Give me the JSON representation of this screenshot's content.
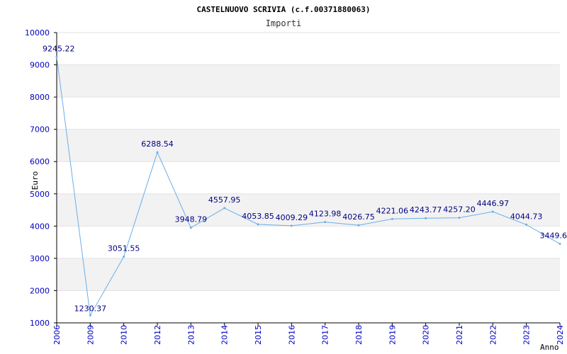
{
  "chart_data": {
    "type": "line",
    "title": "CASTELNUOVO SCRIVIA (c.f.00371880063)",
    "subtitle": "Importi",
    "xlabel": "Anno",
    "ylabel": "Euro",
    "ylim": [
      1000,
      10000
    ],
    "yticks": [
      1000,
      2000,
      3000,
      4000,
      5000,
      6000,
      7000,
      8000,
      9000,
      10000
    ],
    "grid": "alternating horizontal bands",
    "categories": [
      "2006",
      "2009",
      "2010",
      "2012",
      "2013",
      "2014",
      "2015",
      "2016",
      "2017",
      "2018",
      "2019",
      "2020",
      "2021",
      "2022",
      "2023",
      "2024"
    ],
    "series": [
      {
        "values": [
          9245.22,
          1230.37,
          3051.55,
          6288.54,
          3948.79,
          4557.95,
          4053.85,
          4009.29,
          4123.98,
          4026.75,
          4221.06,
          4243.77,
          4257.2,
          4446.97,
          4044.73,
          3449.6
        ],
        "labels": [
          "9245.22",
          "1230.37",
          "3051.55",
          "6288.54",
          "3948.79",
          "4557.95",
          "4053.85",
          "4009.29",
          "4123.98",
          "4026.75",
          "4221.06",
          "4243.77",
          "4257.20",
          "4446.97",
          "4044.73",
          "3449.6"
        ]
      }
    ],
    "colors": {
      "line": "#6aaee8",
      "band": "#f2f2f2",
      "grid": "#e3e3e3",
      "tick_text": "#0000c0",
      "axis": "#000000",
      "label_text": "#000080"
    }
  }
}
